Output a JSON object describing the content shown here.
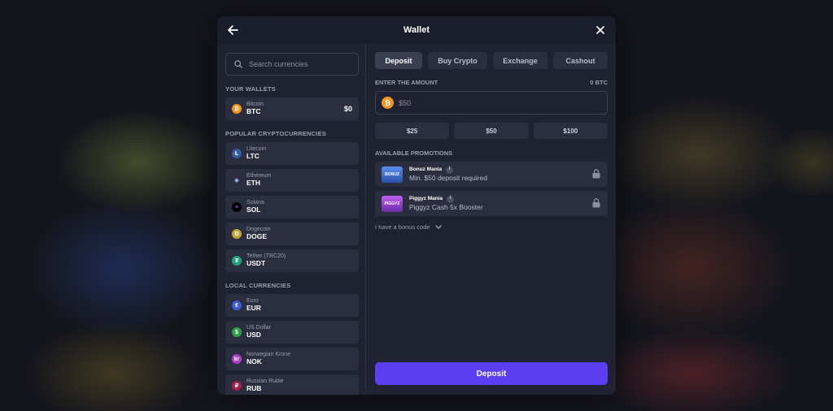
{
  "modal": {
    "title": "Wallet"
  },
  "search": {
    "placeholder": "Search currencies"
  },
  "sections": {
    "your_wallets": "YOUR WALLETS",
    "popular": "POPULAR CRYPTOCURRENCIES",
    "local": "LOCAL CURRENCIES"
  },
  "wallets": [
    {
      "name": "Bitcoin",
      "code": "BTC",
      "balance": "$0",
      "icon": "bitcoin-icon",
      "symbol": "₿",
      "color": "#f7931a"
    }
  ],
  "popular": [
    {
      "name": "Litecoin",
      "code": "LTC",
      "icon": "litecoin-icon",
      "symbol": "Ł",
      "color": "#345d9d"
    },
    {
      "name": "Ethereum",
      "code": "ETH",
      "icon": "ethereum-icon",
      "symbol": "◆",
      "color": "#2a2e3f"
    },
    {
      "name": "Solana",
      "code": "SOL",
      "icon": "solana-icon",
      "symbol": "≡",
      "color": "#000000"
    },
    {
      "name": "Dogecoin",
      "code": "DOGE",
      "icon": "dogecoin-icon",
      "symbol": "Ð",
      "color": "#c2a633"
    },
    {
      "name": "Tether (TRC20)",
      "code": "USDT",
      "icon": "tether-icon",
      "symbol": "₮",
      "color": "#26a17b"
    }
  ],
  "local": [
    {
      "name": "Euro",
      "code": "EUR",
      "icon": "euro-icon",
      "symbol": "€",
      "color": "#3b5bdb"
    },
    {
      "name": "US Dollar",
      "code": "USD",
      "icon": "dollar-icon",
      "symbol": "$",
      "color": "#2f9e44"
    },
    {
      "name": "Norwegian Krone",
      "code": "NOK",
      "icon": "krone-icon",
      "symbol": "kr",
      "color": "#ae3ec9"
    },
    {
      "name": "Russian Ruble",
      "code": "RUB",
      "icon": "ruble-icon",
      "symbol": "₽",
      "color": "#a61e4d"
    }
  ],
  "tabs": [
    {
      "label": "Deposit",
      "active": true
    },
    {
      "label": "Buy Crypto",
      "active": false
    },
    {
      "label": "Exchange",
      "active": false
    },
    {
      "label": "Cashout",
      "active": false
    }
  ],
  "amount": {
    "label": "ENTER THE AMOUNT",
    "balance": "0 BTC",
    "placeholder": "$50"
  },
  "presets": [
    "$25",
    "$50",
    "$100"
  ],
  "promotions": {
    "label": "AVAILABLE PROMOTIONS",
    "items": [
      {
        "title": "Bonuz Mania",
        "desc": "Min. $50 deposit required",
        "logo_text": "BONUZ",
        "logo_color": "#3b6fd6"
      },
      {
        "title": "Piggyz Mania",
        "desc": "Piggyz Cash 5x Booster",
        "logo_text": "PIGGYZ",
        "logo_color": "#8e3fc9"
      }
    ]
  },
  "bonus_code": {
    "label": "I have a bonus code"
  },
  "deposit_button": {
    "label": "Deposit"
  },
  "colors": {
    "accent": "#5b3df2",
    "panel": "#1f2231",
    "row": "#2a2e3f"
  }
}
